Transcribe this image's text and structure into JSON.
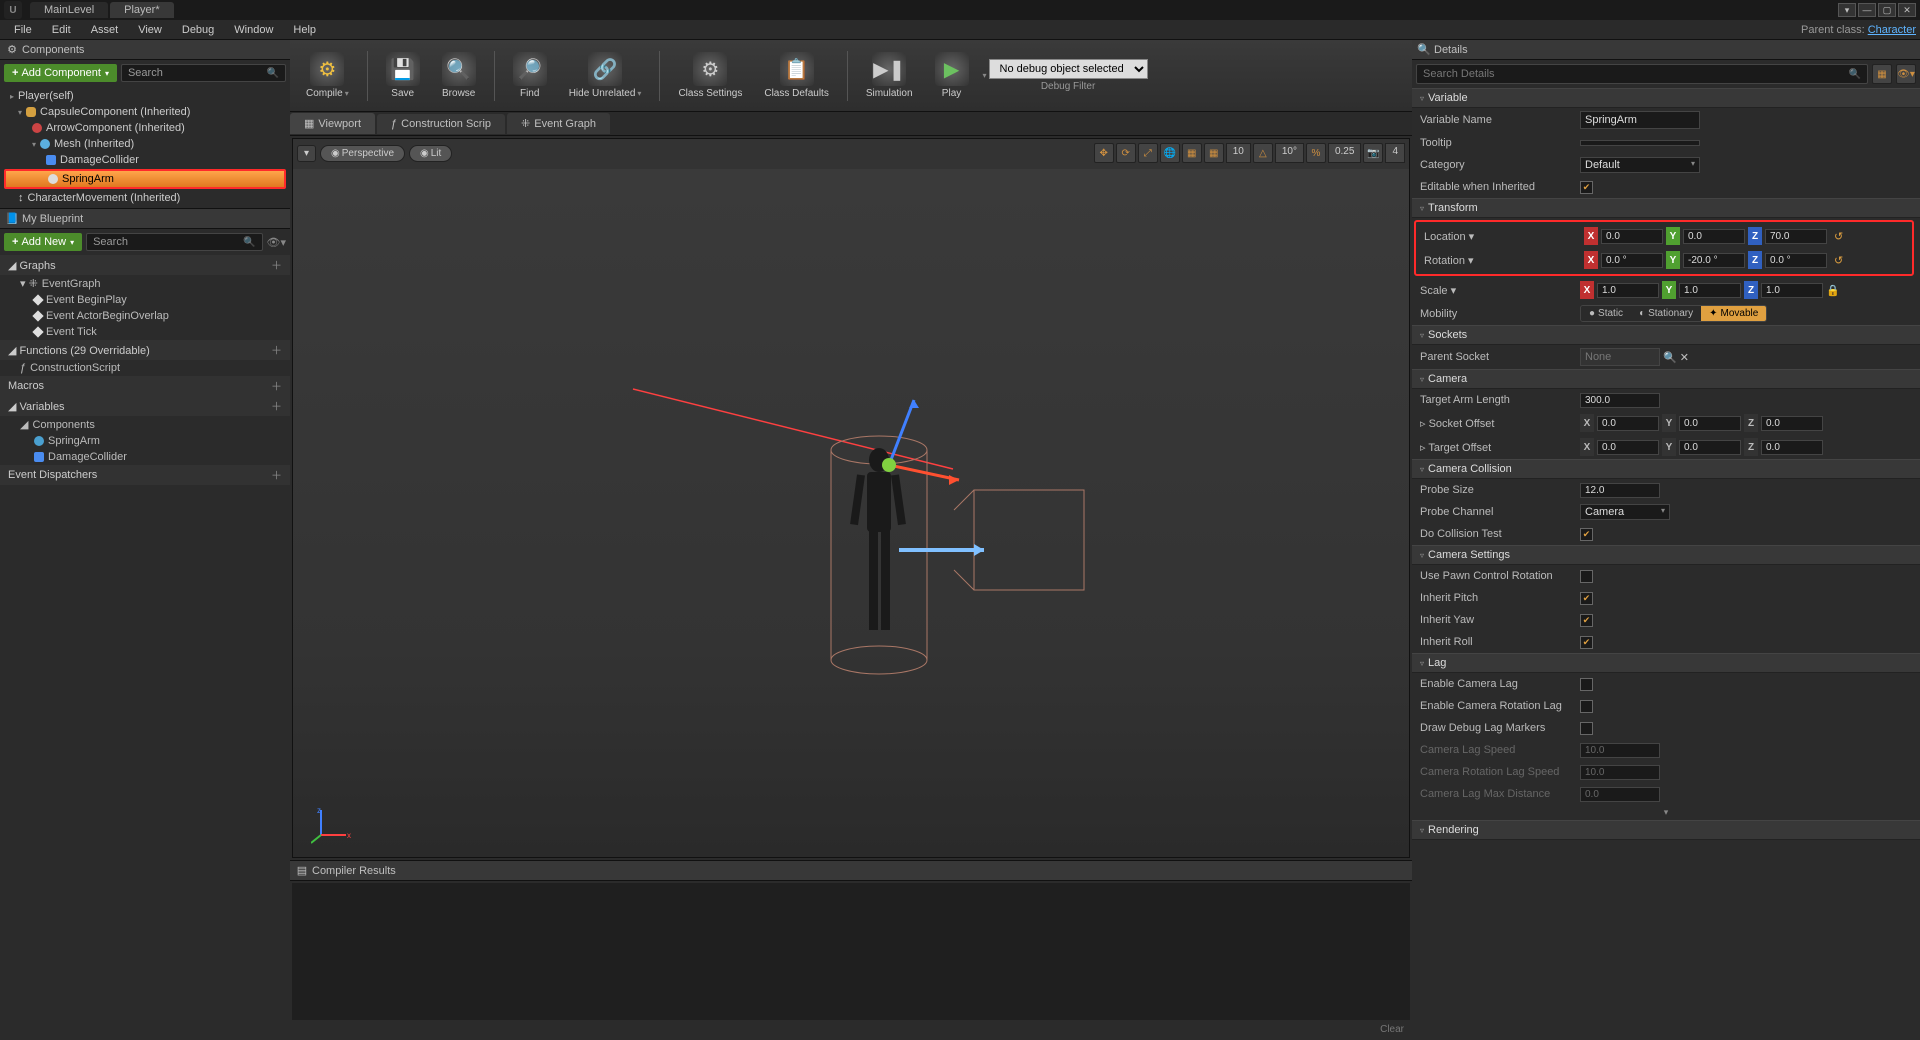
{
  "titlebar": {
    "tabs": [
      "MainLevel",
      "Player*"
    ]
  },
  "menubar": {
    "items": [
      "File",
      "Edit",
      "Asset",
      "View",
      "Debug",
      "Window",
      "Help"
    ],
    "parent_label": "Parent class:",
    "parent_class": "Character"
  },
  "toolbar": {
    "compile": "Compile",
    "save": "Save",
    "browse": "Browse",
    "find": "Find",
    "hide_unrelated": "Hide Unrelated",
    "class_settings": "Class Settings",
    "class_defaults": "Class Defaults",
    "simulation": "Simulation",
    "play": "Play",
    "debug_selected": "No debug object selected",
    "debug_filter": "Debug Filter"
  },
  "components": {
    "header": "Components",
    "add": "Add Component",
    "search_ph": "Search",
    "tree": {
      "root": "Player(self)",
      "capsule": "CapsuleComponent (Inherited)",
      "arrow": "ArrowComponent (Inherited)",
      "mesh": "Mesh (Inherited)",
      "damage": "DamageCollider",
      "spring": "SpringArm",
      "charmove": "CharacterMovement (Inherited)"
    }
  },
  "my_blueprint": {
    "header": "My Blueprint",
    "add": "Add New",
    "search_ph": "Search",
    "graphs": "Graphs",
    "event_graph": "EventGraph",
    "ev_begin": "Event BeginPlay",
    "ev_overlap": "Event ActorBeginOverlap",
    "ev_tick": "Event Tick",
    "functions": "Functions",
    "functions_extra": "(29 Overridable)",
    "construction": "ConstructionScript",
    "macros": "Macros",
    "variables": "Variables",
    "var_comp": "Components",
    "var_spring": "SpringArm",
    "var_damage": "DamageCollider",
    "dispatchers": "Event Dispatchers"
  },
  "editor_tabs": {
    "viewport": "Viewport",
    "construction": "Construction Scrip",
    "event_graph": "Event Graph"
  },
  "viewport": {
    "perspective": "Perspective",
    "lit": "Lit",
    "grid": "10",
    "angle": "10°",
    "scale": "0.25",
    "cam": "4"
  },
  "compiler": {
    "header": "Compiler Results",
    "clear": "Clear"
  },
  "details": {
    "header": "Details",
    "search_ph": "Search Details",
    "variable": {
      "hdr": "Variable",
      "name_lbl": "Variable Name",
      "name_val": "SpringArm",
      "tooltip": "Tooltip",
      "category": "Category",
      "category_val": "Default",
      "editable": "Editable when Inherited"
    },
    "transform": {
      "hdr": "Transform",
      "location": "Location",
      "loc": {
        "x": "0.0",
        "y": "0.0",
        "z": "70.0"
      },
      "rotation": "Rotation",
      "rot": {
        "x": "0.0 °",
        "y": "-20.0 °",
        "z": "0.0 °"
      },
      "scale": "Scale",
      "scl": {
        "x": "1.0",
        "y": "1.0",
        "z": "1.0"
      },
      "mobility": "Mobility",
      "mob_static": "Static",
      "mob_stationary": "Stationary",
      "mob_movable": "Movable"
    },
    "sockets": {
      "hdr": "Sockets",
      "parent": "Parent Socket",
      "none": "None"
    },
    "camera": {
      "hdr": "Camera",
      "arm_len": "Target Arm Length",
      "arm_val": "300.0",
      "socket_off": "Socket Offset",
      "target_off": "Target Offset",
      "off": {
        "x": "0.0",
        "y": "0.0",
        "z": "0.0"
      }
    },
    "collision": {
      "hdr": "Camera Collision",
      "probe_size": "Probe Size",
      "probe_val": "12.0",
      "probe_channel": "Probe Channel",
      "probe_ch_val": "Camera",
      "do_test": "Do Collision Test"
    },
    "cam_settings": {
      "hdr": "Camera Settings",
      "use_pawn": "Use Pawn Control Rotation",
      "inh_pitch": "Inherit Pitch",
      "inh_yaw": "Inherit Yaw",
      "inh_roll": "Inherit Roll"
    },
    "lag": {
      "hdr": "Lag",
      "enable_lag": "Enable Camera Lag",
      "enable_rot": "Enable Camera Rotation Lag",
      "draw_debug": "Draw Debug Lag Markers",
      "lag_speed": "Camera Lag Speed",
      "lag_speed_v": "10.0",
      "rot_speed": "Camera Rotation Lag Speed",
      "rot_speed_v": "10.0",
      "max_dist": "Camera Lag Max Distance",
      "max_dist_v": "0.0"
    },
    "rendering": {
      "hdr": "Rendering"
    }
  }
}
